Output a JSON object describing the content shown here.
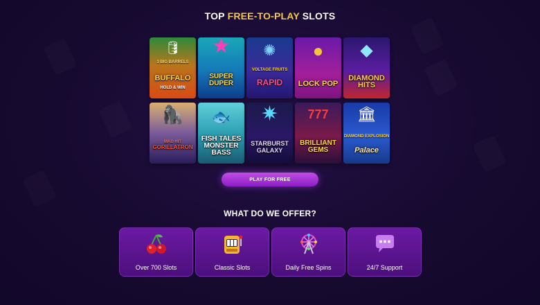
{
  "header": {
    "title_prefix": "TOP ",
    "title_accent": "FREE-TO-PLAY",
    "title_suffix": " SLOTS"
  },
  "slots": [
    {
      "name": "BUFFALO",
      "subtitle": "3 BIG BARRELS",
      "tagline": "HOLD & WIN"
    },
    {
      "name": "SUPER DUPER",
      "subtitle": "",
      "tagline": ""
    },
    {
      "name": "RAPID",
      "subtitle": "VOLTAGE FRUITS",
      "tagline": ""
    },
    {
      "name": "LOCK POP",
      "subtitle": "",
      "tagline": ""
    },
    {
      "name": "DIAMOND HITS",
      "subtitle": "",
      "tagline": ""
    },
    {
      "name": "GORILLATRON",
      "subtitle": "MAD HIT",
      "tagline": ""
    },
    {
      "name": "FISH TALES MONSTER BASS",
      "subtitle": "",
      "tagline": ""
    },
    {
      "name": "STARBURST GALAXY",
      "subtitle": "",
      "tagline": ""
    },
    {
      "name": "BRILLIANT GEMS",
      "subtitle": "",
      "tagline": ""
    },
    {
      "name": "Palace",
      "subtitle": "DIAMOND EXPLOSION",
      "tagline": ""
    }
  ],
  "play_button": {
    "label": "PLAY FOR FREE"
  },
  "offer": {
    "title": "WHAT DO WE OFFER?",
    "items": [
      {
        "label": "Over 700 Slots",
        "icon": "cherries-icon"
      },
      {
        "label": "Classic Slots",
        "icon": "slot-machine-icon"
      },
      {
        "label": "Daily Free Spins",
        "icon": "ferris-wheel-icon"
      },
      {
        "label": "24/7 Support",
        "icon": "chat-bubble-icon"
      }
    ]
  },
  "colors": {
    "accent": "#f6c646",
    "button": "#a535d8",
    "card": "#5e1694",
    "background": "#1a0c36"
  }
}
